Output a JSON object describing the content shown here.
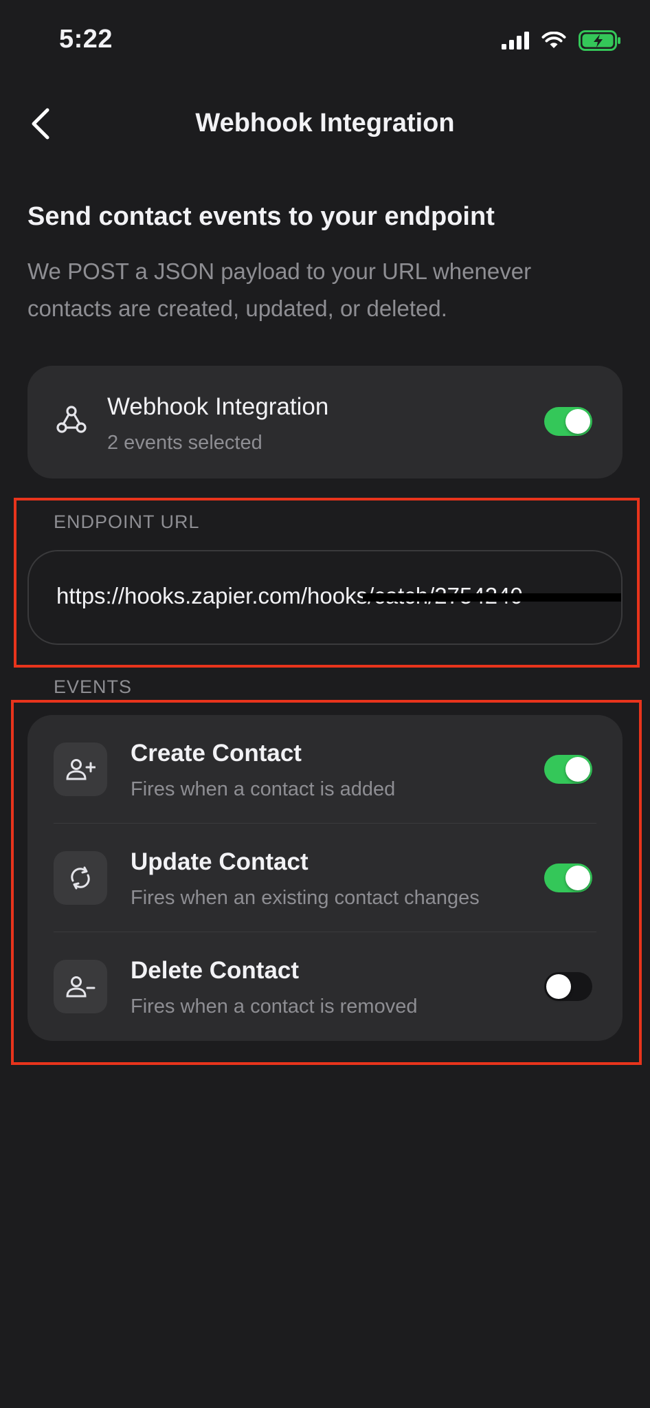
{
  "status_bar": {
    "time": "5:22"
  },
  "nav": {
    "title": "Webhook Integration"
  },
  "intro": {
    "heading": "Send contact events to your endpoint",
    "description": "We POST a JSON payload to your URL whenever contacts are created, updated, or deleted."
  },
  "integration": {
    "title": "Webhook Integration",
    "subtitle": "2 events selected",
    "enabled": true
  },
  "endpoint": {
    "label": "ENDPOINT URL",
    "value": "https://hooks.zapier.com/hooks/catch/2754240"
  },
  "events": {
    "label": "EVENTS",
    "items": [
      {
        "title": "Create Contact",
        "subtitle": "Fires when a contact is added",
        "enabled": true,
        "icon": "person-add-icon"
      },
      {
        "title": "Update Contact",
        "subtitle": "Fires when an existing contact changes",
        "enabled": true,
        "icon": "refresh-icon"
      },
      {
        "title": "Delete Contact",
        "subtitle": "Fires when a contact is removed",
        "enabled": false,
        "icon": "person-remove-icon"
      }
    ]
  },
  "colors": {
    "background": "#1c1c1e",
    "card": "#2c2c2e",
    "toggle_on": "#34c759",
    "highlight": "#e8341c",
    "secondary_text": "#8e8e93"
  }
}
